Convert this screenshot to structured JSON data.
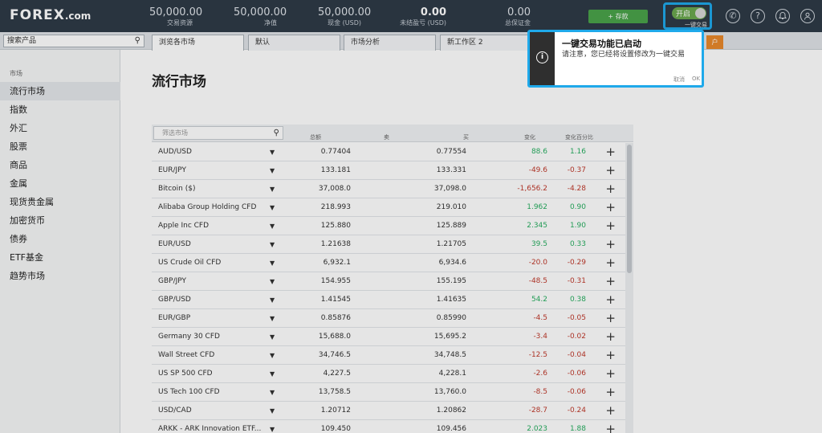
{
  "brand": {
    "logo": "FOREX",
    "logo_suffix": ".com"
  },
  "header": {
    "stats": [
      {
        "value": "50,000.00",
        "label": "交易资源",
        "bold": false
      },
      {
        "value": "50,000.00",
        "label": "净值",
        "bold": false
      },
      {
        "value": "50,000.00",
        "label": "现金 (USD)",
        "bold": false
      },
      {
        "value": "0.00",
        "label": "未结盈亏 (USD)",
        "bold": true
      },
      {
        "value": "0.00",
        "label": "总保证金",
        "bold": false
      }
    ],
    "deposit_label": "+ 存款",
    "one_click": {
      "state_label": "开启",
      "label": "一键交易",
      "enabled": true
    },
    "icons": [
      "phone-icon",
      "help-icon",
      "notification-icon",
      "user-icon"
    ],
    "colors": {
      "bar": "#2e3a47",
      "deposit": "#4aa34a",
      "highlight": "#1fa9ea",
      "toggle_on": "#6aa84f"
    }
  },
  "subbar": {
    "search_placeholder": "搜索产品",
    "tabs": [
      {
        "label": "浏览各市场",
        "active": true
      },
      {
        "label": "默认",
        "active": false
      },
      {
        "label": "市场分析",
        "active": false
      },
      {
        "label": "新工作区 2",
        "active": false
      }
    ],
    "orange_button": "户"
  },
  "sidebar": {
    "heading": "市场",
    "items": [
      {
        "label": "流行市场",
        "active": true
      },
      {
        "label": "指数",
        "active": false
      },
      {
        "label": "外汇",
        "active": false
      },
      {
        "label": "股票",
        "active": false
      },
      {
        "label": "商品",
        "active": false
      },
      {
        "label": "金属",
        "active": false
      },
      {
        "label": "现货贵金属",
        "active": false
      },
      {
        "label": "加密货币",
        "active": false
      },
      {
        "label": "债券",
        "active": false
      },
      {
        "label": "ETF基金",
        "active": false
      },
      {
        "label": "趋势市场",
        "active": false
      }
    ]
  },
  "main": {
    "title": "流行市场",
    "filter_placeholder": "筛选市场",
    "columns": {
      "volume": "总额",
      "sell": "卖",
      "buy": "买",
      "change": "变化",
      "change_pct": "变化百分比"
    },
    "rows": [
      {
        "name": "AUD/USD",
        "sell": "0.77404",
        "buy": "0.77554",
        "change": "88.6",
        "pct": "1.16",
        "dir": "pos"
      },
      {
        "name": "EUR/JPY",
        "sell": "133.181",
        "buy": "133.331",
        "change": "-49.6",
        "pct": "-0.37",
        "dir": "neg"
      },
      {
        "name": "Bitcoin ($)",
        "sell": "37,008.0",
        "buy": "37,098.0",
        "change": "-1,656.2",
        "pct": "-4.28",
        "dir": "neg"
      },
      {
        "name": "Alibaba Group Holding CFD",
        "sell": "218.993",
        "buy": "219.010",
        "change": "1.962",
        "pct": "0.90",
        "dir": "pos"
      },
      {
        "name": "Apple Inc CFD",
        "sell": "125.880",
        "buy": "125.889",
        "change": "2.345",
        "pct": "1.90",
        "dir": "pos"
      },
      {
        "name": "EUR/USD",
        "sell": "1.21638",
        "buy": "1.21705",
        "change": "39.5",
        "pct": "0.33",
        "dir": "pos"
      },
      {
        "name": "US Crude Oil CFD",
        "sell": "6,932.1",
        "buy": "6,934.6",
        "change": "-20.0",
        "pct": "-0.29",
        "dir": "neg"
      },
      {
        "name": "GBP/JPY",
        "sell": "154.955",
        "buy": "155.195",
        "change": "-48.5",
        "pct": "-0.31",
        "dir": "neg"
      },
      {
        "name": "GBP/USD",
        "sell": "1.41545",
        "buy": "1.41635",
        "change": "54.2",
        "pct": "0.38",
        "dir": "pos"
      },
      {
        "name": "EUR/GBP",
        "sell": "0.85876",
        "buy": "0.85990",
        "change": "-4.5",
        "pct": "-0.05",
        "dir": "neg"
      },
      {
        "name": "Germany 30 CFD",
        "sell": "15,688.0",
        "buy": "15,695.2",
        "change": "-3.4",
        "pct": "-0.02",
        "dir": "neg"
      },
      {
        "name": "Wall Street CFD",
        "sell": "34,746.5",
        "buy": "34,748.5",
        "change": "-12.5",
        "pct": "-0.04",
        "dir": "neg"
      },
      {
        "name": "US SP 500 CFD",
        "sell": "4,227.5",
        "buy": "4,228.1",
        "change": "-2.6",
        "pct": "-0.06",
        "dir": "neg"
      },
      {
        "name": "US Tech 100 CFD",
        "sell": "13,758.5",
        "buy": "13,760.0",
        "change": "-8.5",
        "pct": "-0.06",
        "dir": "neg"
      },
      {
        "name": "USD/CAD",
        "sell": "1.20712",
        "buy": "1.20862",
        "change": "-28.7",
        "pct": "-0.24",
        "dir": "neg"
      },
      {
        "name": "ARKK - ARK Innovation ETF...",
        "sell": "109.450",
        "buy": "109.456",
        "change": "2.023",
        "pct": "1.88",
        "dir": "pos"
      }
    ],
    "colors": {
      "positive": "#27ae60",
      "negative": "#c0392b"
    }
  },
  "popup": {
    "title": "一键交易功能已启动",
    "body": "请注意，您已经将设置修改为一键交易",
    "cancel": "取消",
    "ok": "OK"
  }
}
